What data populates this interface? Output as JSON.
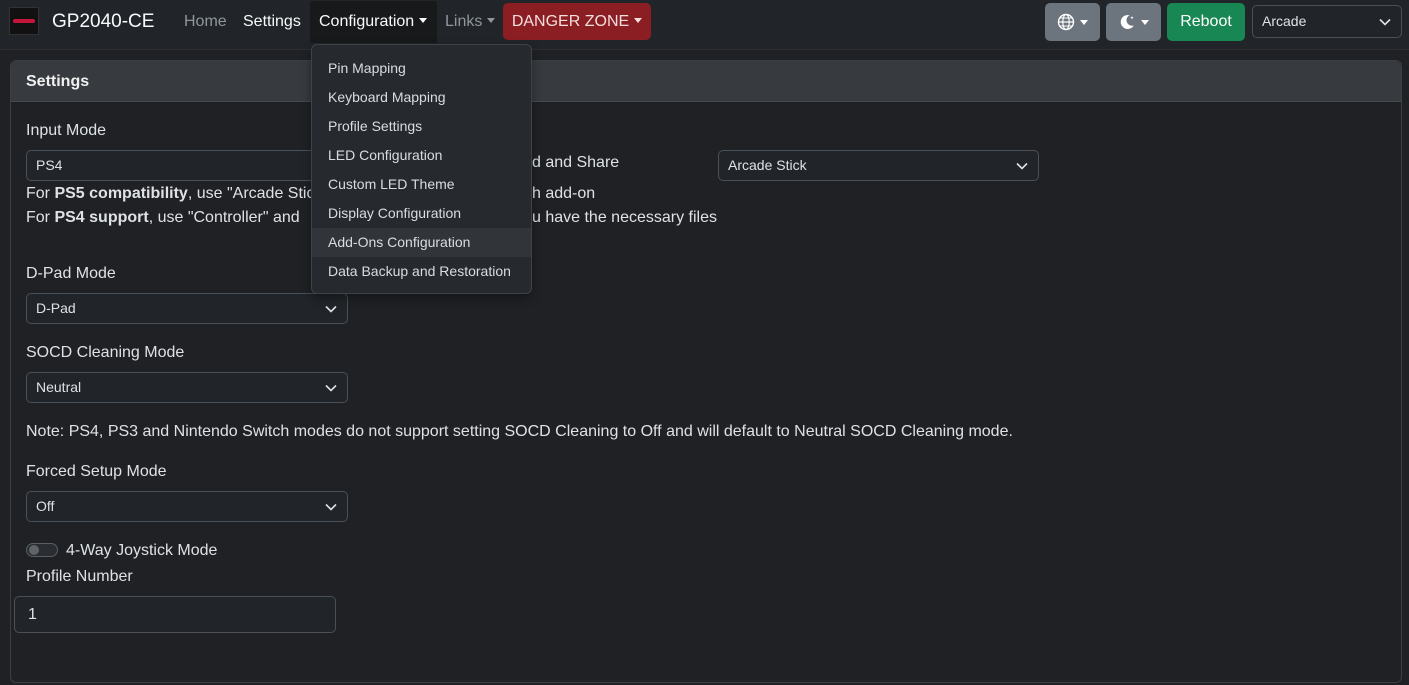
{
  "navbar": {
    "brand": "GP2040-CE",
    "links": {
      "home": "Home",
      "settings": "Settings",
      "configuration": "Configuration",
      "links": "Links",
      "danger_zone": "DANGER ZONE"
    },
    "reboot_label": "Reboot",
    "profile_selected": "Arcade",
    "icons": [
      "globe-icon",
      "moon-icon"
    ]
  },
  "card": {
    "title": "Settings",
    "input_mode": {
      "label": "Input Mode",
      "value": "PS4",
      "help_line1_prefix": "For ",
      "help_line1_bold": "PS5 compatibility",
      "help_line1_text": ", use \"Arcade Stic",
      "help_line1_tail": "h add-on",
      "help_line2_prefix": "For ",
      "help_line2_bold": "PS4 support",
      "help_line2_text": ", use \"Controller\" and",
      "help_line2_tail": "u have the necessary files"
    },
    "ps4_mode": {
      "label_tail": "d and Share",
      "value": "Arcade Stick"
    },
    "dpad_mode": {
      "label": "D-Pad Mode",
      "value": "D-Pad"
    },
    "socd_mode": {
      "label": "SOCD Cleaning Mode",
      "value": "Neutral"
    },
    "socd_note": "Note: PS4, PS3 and Nintendo Switch modes do not support setting SOCD Cleaning to Off and will default to Neutral SOCD Cleaning mode.",
    "forced_setup": {
      "label": "Forced Setup Mode",
      "value": "Off"
    },
    "joystick_4way": {
      "label": "4-Way Joystick Mode",
      "enabled": false
    },
    "profile_number": {
      "label": "Profile Number",
      "value": "1"
    }
  },
  "config_menu": {
    "items": [
      "Pin Mapping",
      "Keyboard Mapping",
      "Profile Settings",
      "LED Configuration",
      "Custom LED Theme",
      "Display Configuration",
      "Add-Ons Configuration",
      "Data Backup and Restoration"
    ],
    "highlighted": "Add-Ons Configuration"
  },
  "colors": {
    "background": "#1f2124",
    "danger": "#8b1e22",
    "reboot": "#198754",
    "icon_button": "#6c757d"
  }
}
